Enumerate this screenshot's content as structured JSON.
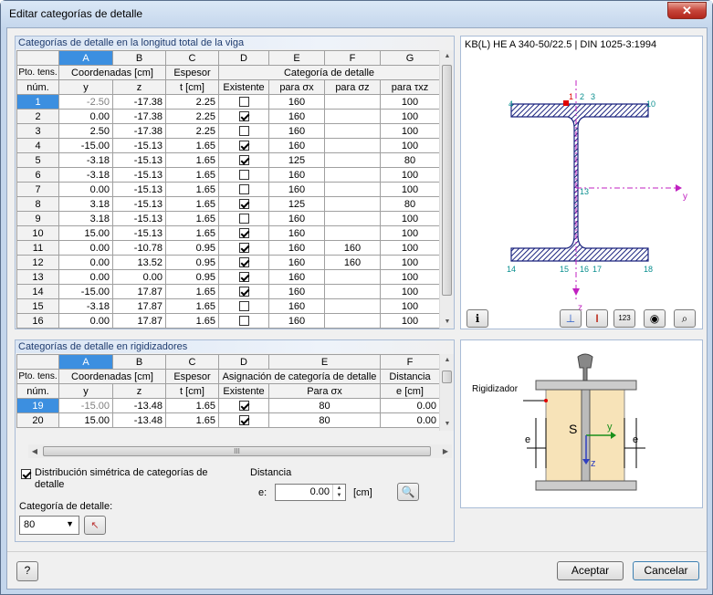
{
  "window": {
    "title": "Editar categorías de detalle",
    "close": "✕"
  },
  "girder": {
    "section_title": "Categorías de detalle en la longitud total de la viga",
    "col_letters": [
      "A",
      "B",
      "C",
      "D",
      "E",
      "F",
      "G"
    ],
    "hdr1": {
      "pto": "Pto. tens.",
      "coords": "Coordenadas [cm]",
      "esp": "Espesor",
      "cat": "Categoría de detalle"
    },
    "hdr2": {
      "num": "núm.",
      "y": "y",
      "z": "z",
      "t": "t [cm]",
      "exist": "Existente",
      "sx": "para σx",
      "sz": "para σz",
      "txz": "para τxz"
    },
    "rows": [
      {
        "n": "1",
        "y": "-2.50",
        "z": "-17.38",
        "t": "2.25",
        "ex": false,
        "sx": "160",
        "sz": "",
        "txz": "100"
      },
      {
        "n": "2",
        "y": "0.00",
        "z": "-17.38",
        "t": "2.25",
        "ex": true,
        "sx": "160",
        "sz": "",
        "txz": "100"
      },
      {
        "n": "3",
        "y": "2.50",
        "z": "-17.38",
        "t": "2.25",
        "ex": false,
        "sx": "160",
        "sz": "",
        "txz": "100"
      },
      {
        "n": "4",
        "y": "-15.00",
        "z": "-15.13",
        "t": "1.65",
        "ex": true,
        "sx": "160",
        "sz": "",
        "txz": "100"
      },
      {
        "n": "5",
        "y": "-3.18",
        "z": "-15.13",
        "t": "1.65",
        "ex": true,
        "sx": "125",
        "sz": "",
        "txz": "80"
      },
      {
        "n": "6",
        "y": "-3.18",
        "z": "-15.13",
        "t": "1.65",
        "ex": false,
        "sx": "160",
        "sz": "",
        "txz": "100"
      },
      {
        "n": "7",
        "y": "0.00",
        "z": "-15.13",
        "t": "1.65",
        "ex": false,
        "sx": "160",
        "sz": "",
        "txz": "100"
      },
      {
        "n": "8",
        "y": "3.18",
        "z": "-15.13",
        "t": "1.65",
        "ex": true,
        "sx": "125",
        "sz": "",
        "txz": "80"
      },
      {
        "n": "9",
        "y": "3.18",
        "z": "-15.13",
        "t": "1.65",
        "ex": false,
        "sx": "160",
        "sz": "",
        "txz": "100"
      },
      {
        "n": "10",
        "y": "15.00",
        "z": "-15.13",
        "t": "1.65",
        "ex": true,
        "sx": "160",
        "sz": "",
        "txz": "100"
      },
      {
        "n": "11",
        "y": "0.00",
        "z": "-10.78",
        "t": "0.95",
        "ex": true,
        "sx": "160",
        "sz": "160",
        "txz": "100"
      },
      {
        "n": "12",
        "y": "0.00",
        "z": "13.52",
        "t": "0.95",
        "ex": true,
        "sx": "160",
        "sz": "160",
        "txz": "100"
      },
      {
        "n": "13",
        "y": "0.00",
        "z": "0.00",
        "t": "0.95",
        "ex": true,
        "sx": "160",
        "sz": "",
        "txz": "100"
      },
      {
        "n": "14",
        "y": "-15.00",
        "z": "17.87",
        "t": "1.65",
        "ex": true,
        "sx": "160",
        "sz": "",
        "txz": "100"
      },
      {
        "n": "15",
        "y": "-3.18",
        "z": "17.87",
        "t": "1.65",
        "ex": false,
        "sx": "160",
        "sz": "",
        "txz": "100"
      },
      {
        "n": "16",
        "y": "0.00",
        "z": "17.87",
        "t": "1.65",
        "ex": false,
        "sx": "160",
        "sz": "",
        "txz": "100"
      }
    ]
  },
  "stiff": {
    "section_title": "Categorías de detalle en rigidizadores",
    "col_letters": [
      "A",
      "B",
      "C",
      "D",
      "E",
      "F"
    ],
    "hdr1": {
      "pto": "Pto. tens.",
      "coords": "Coordenadas [cm]",
      "esp": "Espesor",
      "asig": "Asignación de categoría de detalle",
      "dist": "Distancia"
    },
    "hdr2": {
      "num": "núm.",
      "y": "y",
      "z": "z",
      "t": "t [cm]",
      "exist": "Existente",
      "sx": "Para σx",
      "e": "e [cm]"
    },
    "rows": [
      {
        "n": "19",
        "y": "-15.00",
        "z": "-13.48",
        "t": "1.65",
        "ex": true,
        "sx": "80",
        "e": "0.00"
      },
      {
        "n": "20",
        "y": "15.00",
        "z": "-13.48",
        "t": "1.65",
        "ex": true,
        "sx": "80",
        "e": "0.00"
      }
    ]
  },
  "hscroll_grip": "III",
  "options": {
    "sym_label": "Distribución simétrica de categorías de detalle",
    "cat_label": "Categoría de detalle:",
    "cat_value": "80",
    "dist_label": "Distancia",
    "e_label": "e:",
    "e_value": "0.00",
    "e_unit": "[cm]"
  },
  "section_graphic": {
    "title": "KB(L) HE A 340-50/22.5 | DIN 1025-3:1994",
    "points": [
      "1",
      "2",
      "3",
      "4",
      "10",
      "13",
      "14",
      "15",
      "16",
      "17",
      "18"
    ],
    "axis_y": "y",
    "axis_z": "z",
    "button_123": "123"
  },
  "stiffener_graphic": {
    "label": "Rigidizador",
    "s": "S",
    "y": "y",
    "z": "z",
    "e_left": "e",
    "e_right": "e"
  },
  "footer": {
    "ok": "Aceptar",
    "cancel": "Cancelar"
  }
}
